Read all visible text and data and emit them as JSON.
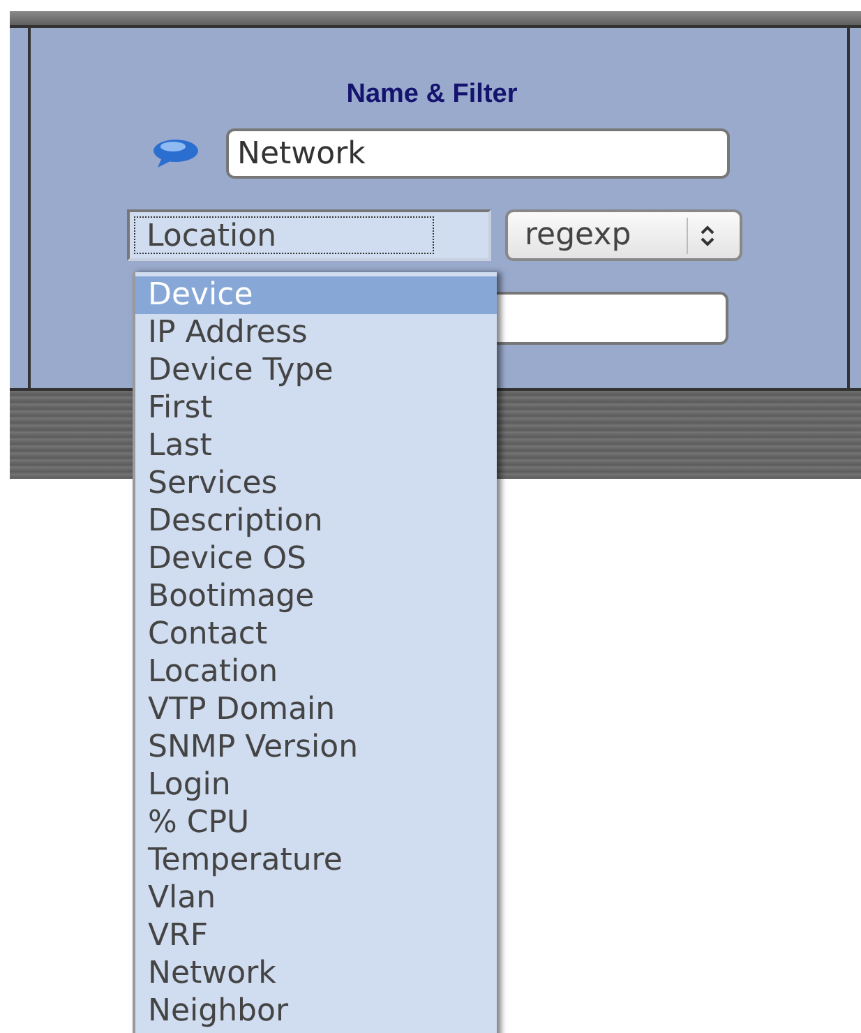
{
  "panel": {
    "title": "Name & Filter"
  },
  "name_field": {
    "value": "Network"
  },
  "filter": {
    "field": "Location",
    "match": "regexp",
    "expanded": true
  },
  "dropdown": [
    {
      "label": "Device",
      "selected": true
    },
    {
      "label": "IP Address",
      "selected": false
    },
    {
      "label": "Device Type",
      "selected": false
    },
    {
      "label": "First",
      "selected": false
    },
    {
      "label": "Last",
      "selected": false
    },
    {
      "label": "Services",
      "selected": false
    },
    {
      "label": "Description",
      "selected": false
    },
    {
      "label": "Device OS",
      "selected": false
    },
    {
      "label": "Bootimage",
      "selected": false
    },
    {
      "label": "Contact",
      "selected": false
    },
    {
      "label": "Location",
      "selected": false
    },
    {
      "label": "VTP Domain",
      "selected": false
    },
    {
      "label": "SNMP Version",
      "selected": false
    },
    {
      "label": "Login",
      "selected": false
    },
    {
      "label": "% CPU",
      "selected": false
    },
    {
      "label": "Temperature",
      "selected": false
    },
    {
      "label": "Vlan",
      "selected": false
    },
    {
      "label": "VRF",
      "selected": false
    },
    {
      "label": "Network",
      "selected": false
    },
    {
      "label": "Neighbor",
      "selected": false
    }
  ]
}
